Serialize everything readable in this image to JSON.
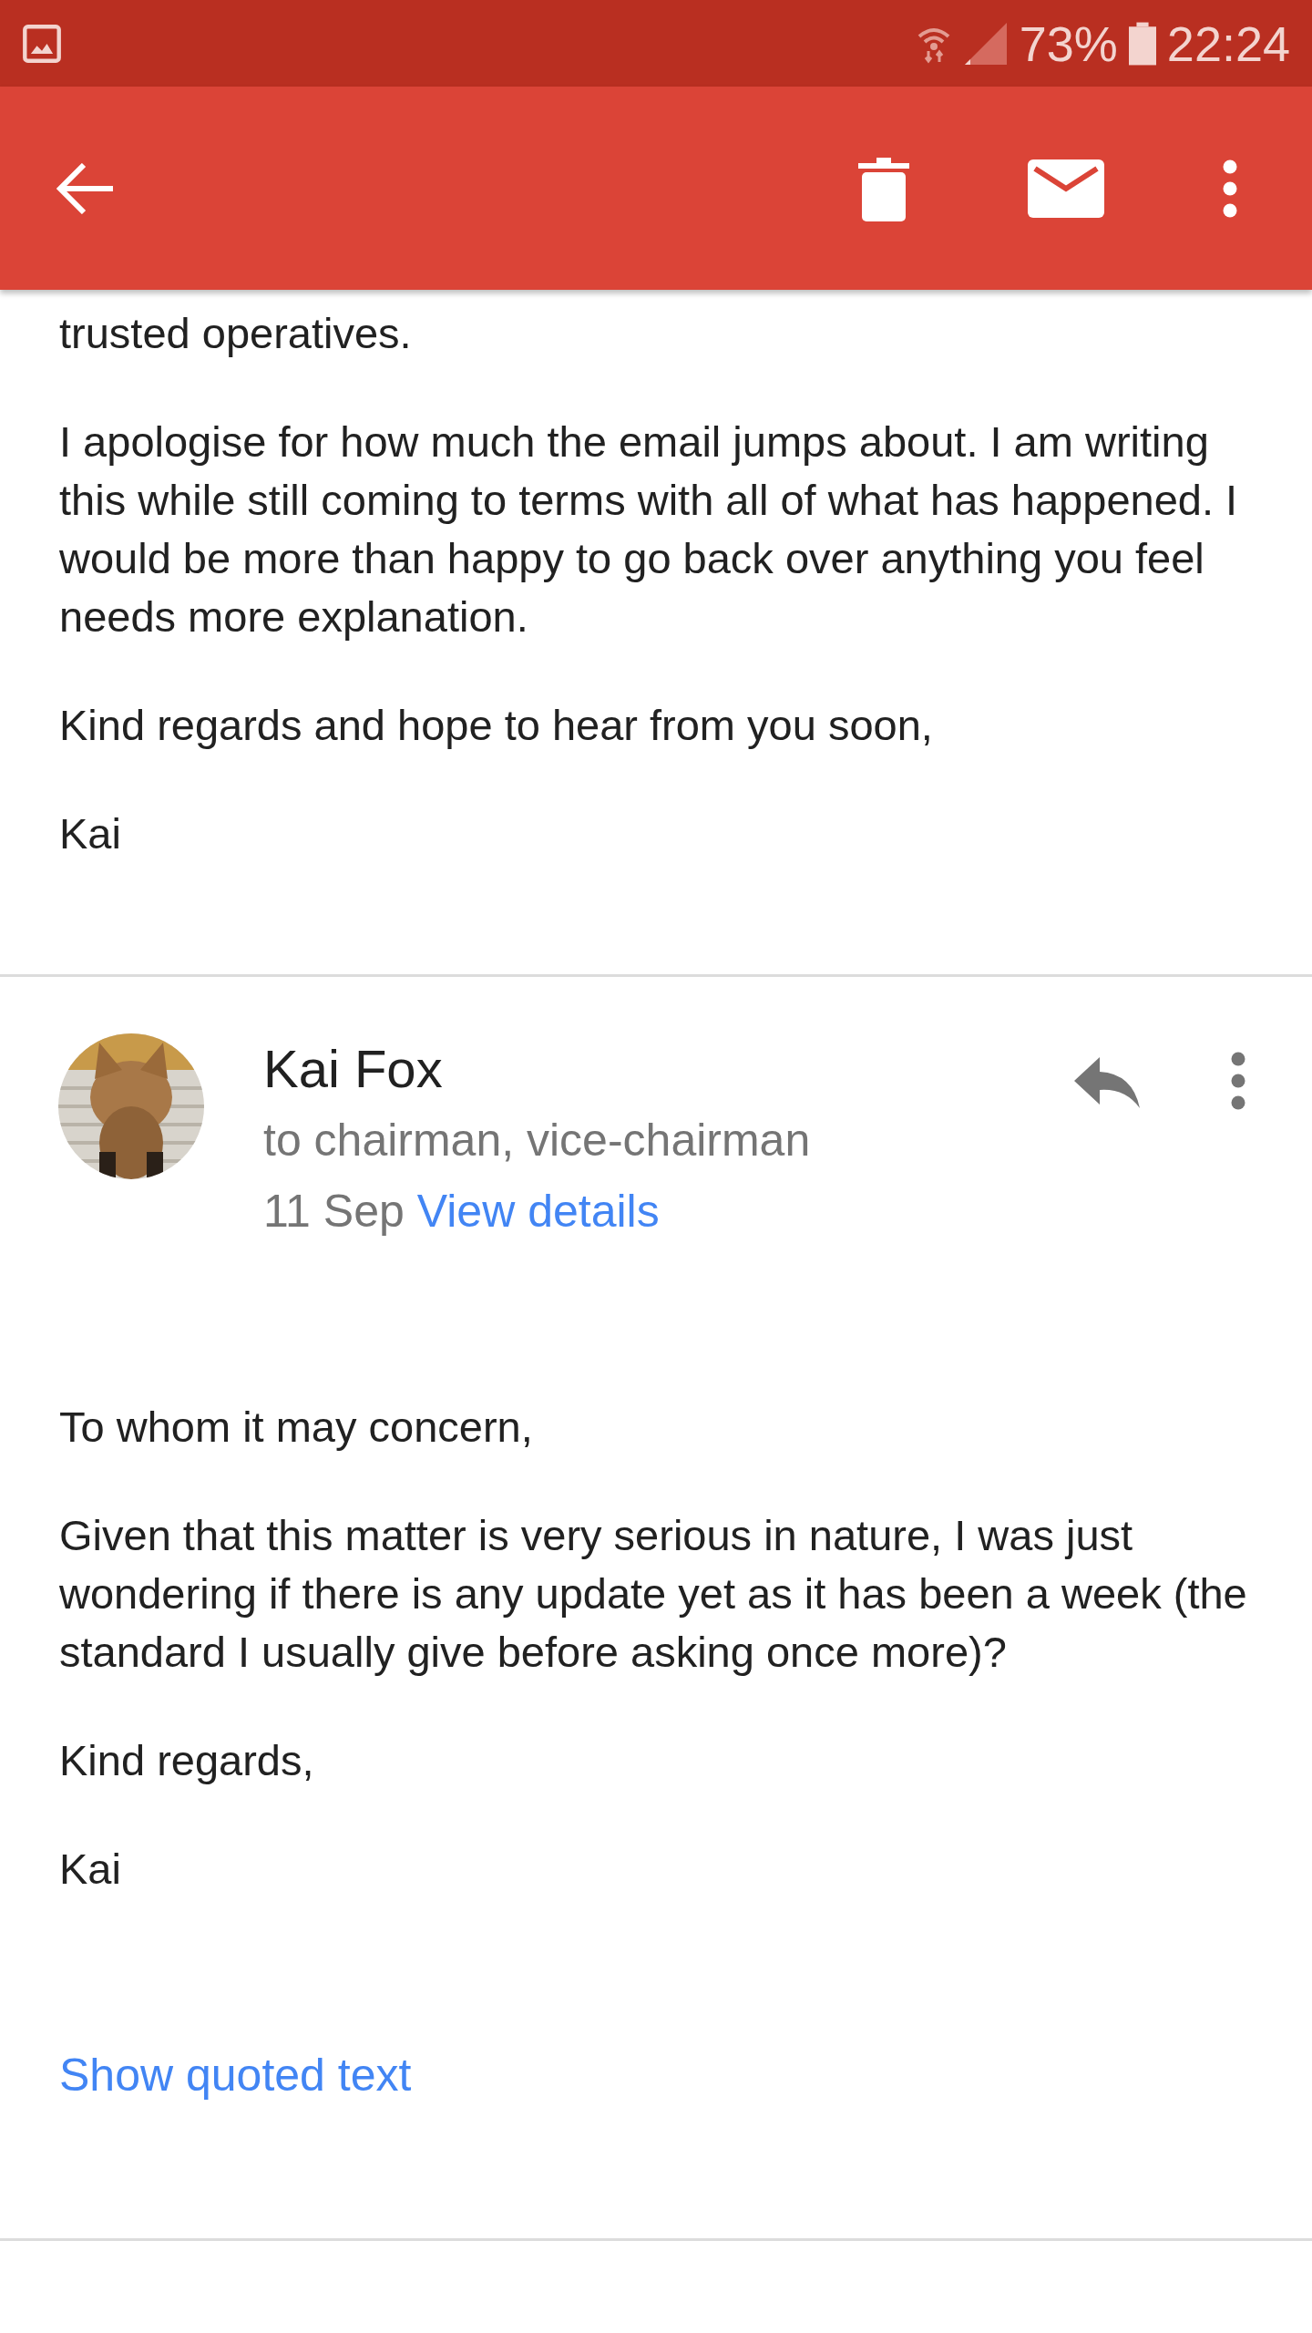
{
  "status_bar": {
    "battery": "73%",
    "time": "22:24"
  },
  "previous_message": {
    "paragraphs": [
      "trusted operatives.",
      "I apologise for how much the email jumps about. I am writing this while still coming to terms with all of what has happened. I would be more than happy to go back over anything you feel needs more explanation.",
      "Kind regards and hope to hear from you soon,",
      "Kai"
    ]
  },
  "message": {
    "sender": "Kai Fox",
    "recipients": "to chairman, vice-chairman",
    "date": "11 Sep",
    "details_link": "View details",
    "paragraphs": [
      "To whom it may concern,",
      "Given that this matter is very serious in nature, I was just wondering if there is any update yet as it has been a week (the standard I usually give before asking once more)?",
      "Kind regards,",
      "Kai"
    ],
    "quoted_link": "Show quoted text"
  }
}
